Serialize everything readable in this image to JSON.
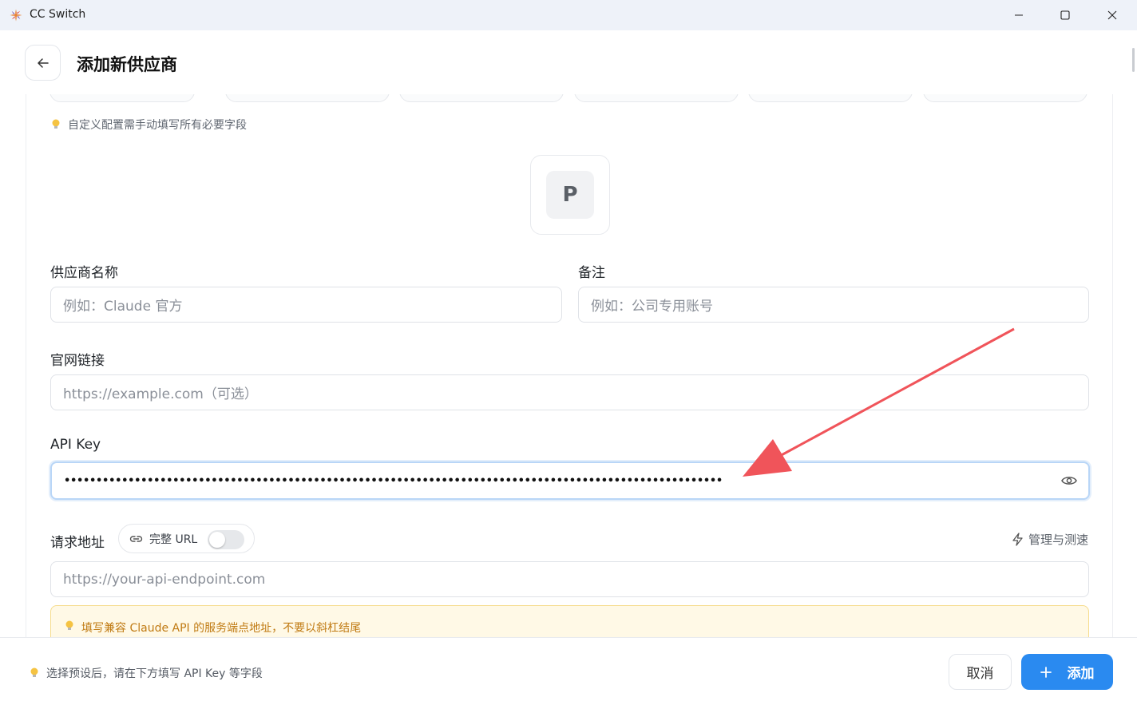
{
  "window": {
    "title": "CC Switch"
  },
  "header": {
    "title": "添加新供应商"
  },
  "form": {
    "custom_hint": "自定义配置需手动填写所有必要字段",
    "icon_letter": "P",
    "provider_name": {
      "label": "供应商名称",
      "placeholder": "例如：Claude 官方"
    },
    "notes": {
      "label": "备注",
      "placeholder": "例如：公司专用账号"
    },
    "website": {
      "label": "官网链接",
      "placeholder": "https://example.com（可选）"
    },
    "api_key": {
      "label": "API Key",
      "value": "•••••••••••••••••••••••••••••••••••••••••••••••••••••••••••••••••••••••••••••••••••••••••••••••••••••••"
    },
    "endpoint": {
      "label": "请求地址",
      "full_url_toggle_label": "完整 URL",
      "full_url_enabled": false,
      "manage_label": "管理与测速",
      "placeholder": "https://your-api-endpoint.com",
      "warning": "填写兼容 Claude API 的服务端点地址，不要以斜杠结尾"
    }
  },
  "footer": {
    "hint": "选择预设后，请在下方填写 API Key 等字段",
    "cancel_label": "取消",
    "add_label": "添加"
  },
  "colors": {
    "accent": "#2a8af0",
    "annotation_arrow": "#f0545a",
    "warning_text": "#c07a12"
  }
}
